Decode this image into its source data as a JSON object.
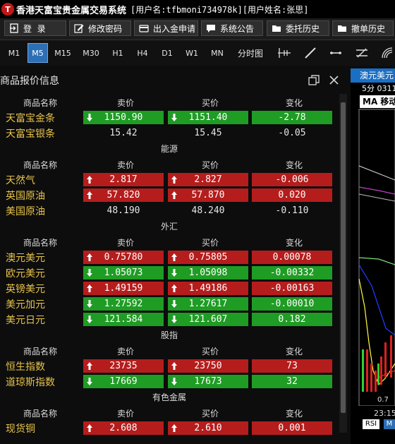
{
  "window": {
    "logo_text": "T",
    "app_title": "香港天富宝贵金属交易系统",
    "user_info": "[用户名:tfbmoni734978k][用户姓名:张思]"
  },
  "toolbar": [
    {
      "label": "登  录",
      "icon": "login-icon"
    },
    {
      "label": "修改密码",
      "icon": "edit-icon"
    },
    {
      "label": "出入金申请",
      "icon": "card-icon"
    },
    {
      "label": "系统公告",
      "icon": "chat-icon"
    },
    {
      "label": "委托历史",
      "icon": "folder-icon"
    },
    {
      "label": "撤单历史",
      "icon": "folder-icon"
    }
  ],
  "timeframes": {
    "items": [
      "M1",
      "M5",
      "M15",
      "M30",
      "H1",
      "H4",
      "D1",
      "W1",
      "MN",
      "分时图"
    ],
    "active": "M5"
  },
  "panel": {
    "title": "商品报价信息"
  },
  "columns": {
    "name": "商品名称",
    "sell": "卖价",
    "buy": "买价",
    "change": "变化"
  },
  "sections": [
    {
      "title": "",
      "rows": [
        {
          "name": "天富宝金条",
          "sell": "1150.90",
          "buy": "1151.40",
          "change": "-2.78",
          "dir": "down"
        },
        {
          "name": "天富宝银条",
          "sell": "15.42",
          "buy": "15.45",
          "change": "-0.05",
          "dir": "flat"
        }
      ]
    },
    {
      "title": "能源",
      "rows": [
        {
          "name": "天然气",
          "sell": "2.817",
          "buy": "2.827",
          "change": "-0.006",
          "dir": "up"
        },
        {
          "name": "英国原油",
          "sell": "57.820",
          "buy": "57.870",
          "change": "0.020",
          "dir": "up"
        },
        {
          "name": "美国原油",
          "sell": "48.190",
          "buy": "48.240",
          "change": "-0.110",
          "dir": "flat"
        }
      ]
    },
    {
      "title": "外汇",
      "rows": [
        {
          "name": "澳元美元",
          "sell": "0.75780",
          "buy": "0.75805",
          "change": "0.00078",
          "dir": "up"
        },
        {
          "name": "欧元美元",
          "sell": "1.05073",
          "buy": "1.05098",
          "change": "-0.00332",
          "dir": "down"
        },
        {
          "name": "英镑美元",
          "sell": "1.49159",
          "buy": "1.49186",
          "change": "-0.00163",
          "dir": "up"
        },
        {
          "name": "美元加元",
          "sell": "1.27592",
          "buy": "1.27617",
          "change": "-0.00010",
          "dir": "down"
        },
        {
          "name": "美元日元",
          "sell": "121.584",
          "buy": "121.607",
          "change": "0.182",
          "dir": "down"
        }
      ]
    },
    {
      "title": "股指",
      "rows": [
        {
          "name": "恒生指数",
          "sell": "23735",
          "buy": "23750",
          "change": "73",
          "dir": "up"
        },
        {
          "name": "道琼斯指数",
          "sell": "17669",
          "buy": "17673",
          "change": "32",
          "dir": "down"
        }
      ]
    },
    {
      "title": "有色金属",
      "rows": [
        {
          "name": "现货铜",
          "sell": "2.608",
          "buy": "2.610",
          "change": "0.001",
          "dir": "up"
        }
      ]
    }
  ],
  "chart_window": {
    "tab_title": "澳元美元",
    "period_label": "5分  0311",
    "indicator_label": "MA 移动",
    "price_label": "0.7",
    "time_label": "23:15",
    "bottom_tabs": [
      "RSI",
      "M"
    ]
  },
  "colors": {
    "up": "#b51d1d",
    "down": "#1f9c24",
    "name": "#e8c34a",
    "accent": "#2d6fb5"
  }
}
